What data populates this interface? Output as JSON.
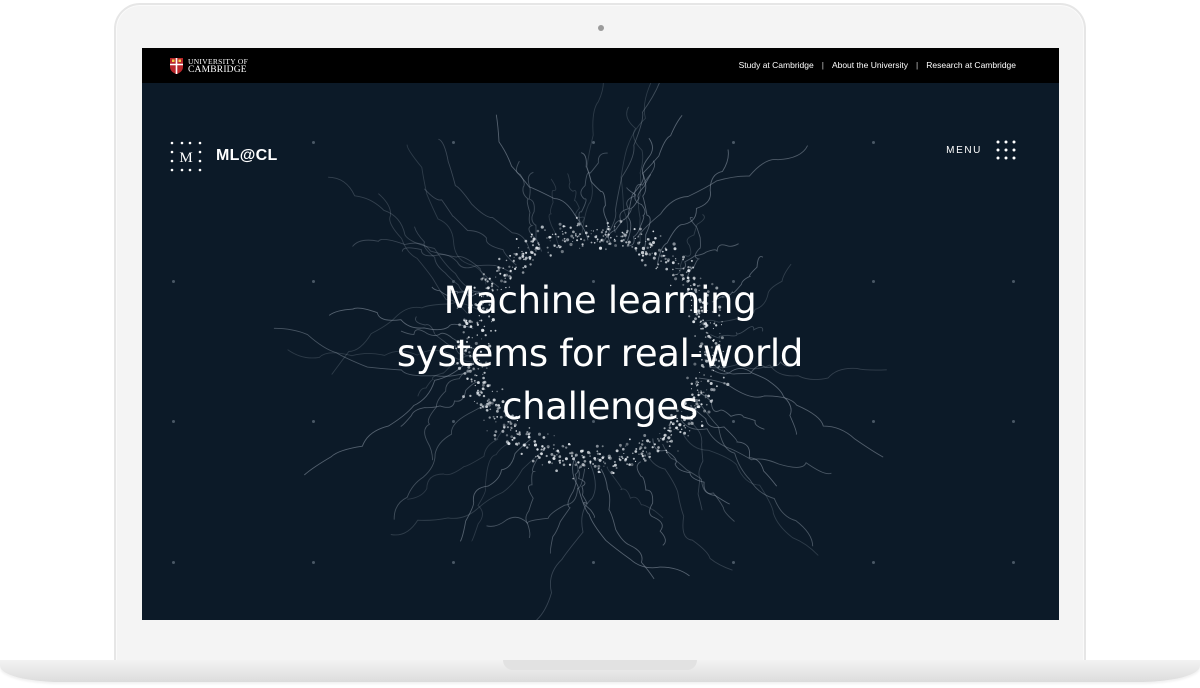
{
  "university": {
    "logo_line1": "UNIVERSITY OF",
    "logo_line2": "CAMBRIDGE"
  },
  "top_links": [
    {
      "label": "Study at Cambridge"
    },
    {
      "label": "About the University"
    },
    {
      "label": "Research at Cambridge"
    }
  ],
  "top_link_separator": "|",
  "brand": {
    "name": "ML@CL",
    "mark_letter": "M",
    "mark_icon": "dotted-m-logo-icon"
  },
  "menu": {
    "label": "MENU",
    "icon": "nine-dot-grid-icon"
  },
  "hero": {
    "line1": "Machine learning",
    "line2": "systems for real-world",
    "line3": "challenges"
  },
  "colors": {
    "screen_bg": "#0c1a28",
    "topbar_bg": "#000000",
    "text": "#ffffff",
    "grid_dot": "#4a5866",
    "cambridge_red": "#b8262a"
  }
}
